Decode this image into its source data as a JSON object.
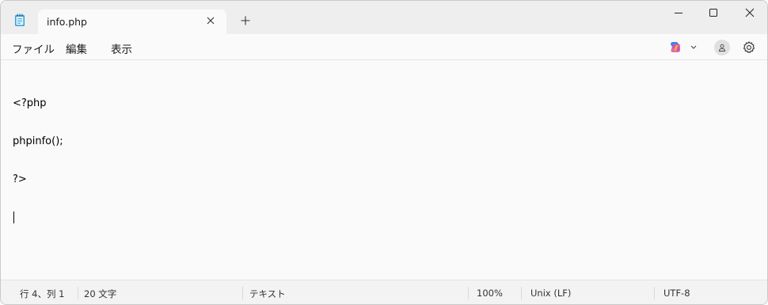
{
  "tab": {
    "title": "info.php"
  },
  "menu": {
    "items": [
      "ファイル",
      "編集",
      "表示"
    ]
  },
  "editor": {
    "lines": [
      "<?php",
      "phpinfo();",
      "?>",
      ""
    ]
  },
  "status": {
    "position": "行 4、列 1",
    "characters": "20 文字",
    "format": "テキスト",
    "zoom": "100%",
    "line_ending": "Unix (LF)",
    "encoding": "UTF-8"
  }
}
